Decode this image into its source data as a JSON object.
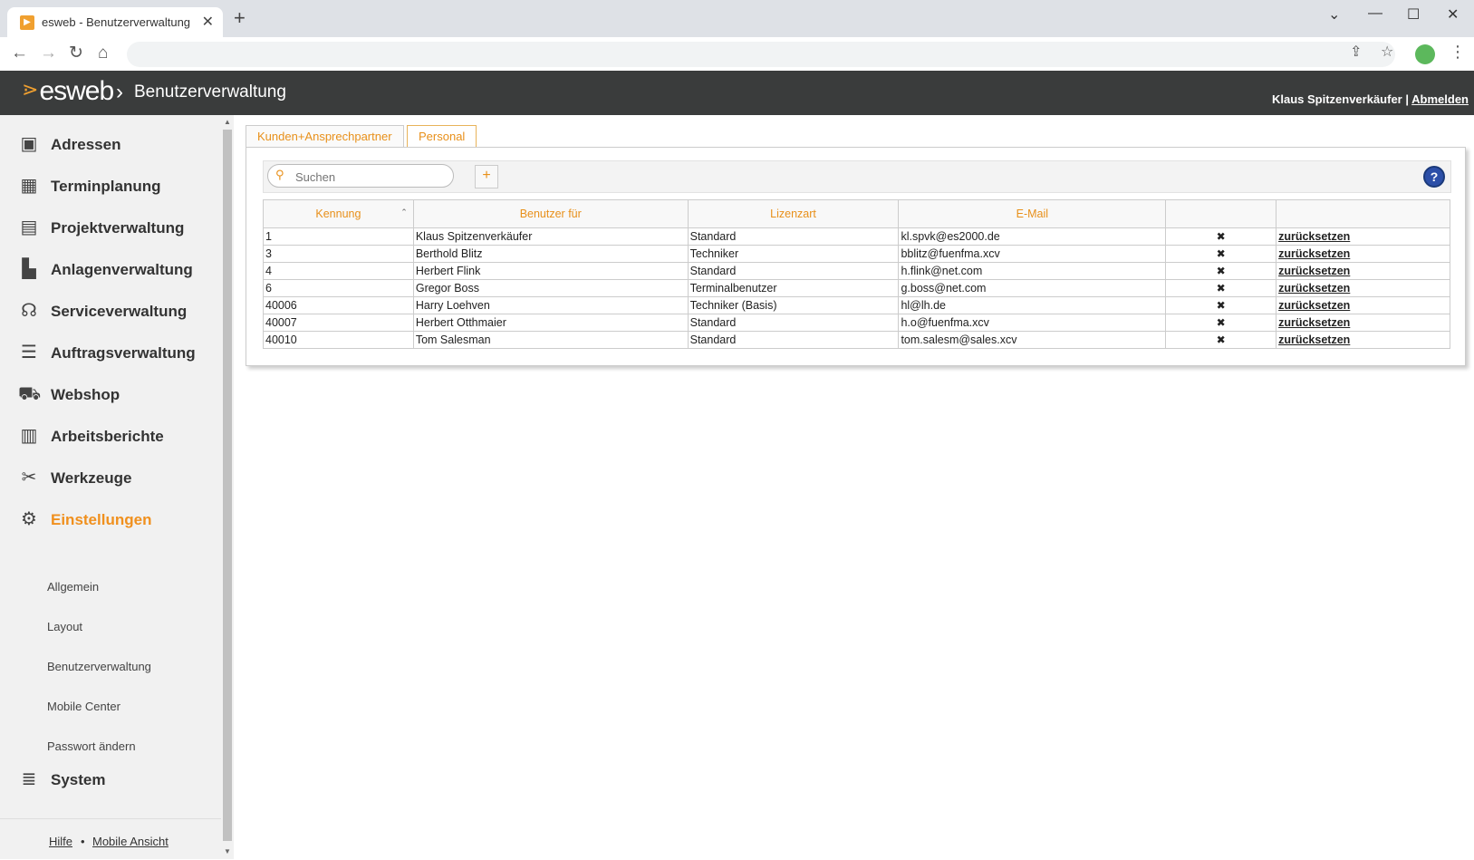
{
  "browser": {
    "tab_title": "esweb - Benutzerverwaltung",
    "tab_close": "✕",
    "new_tab": "+"
  },
  "header": {
    "logo": "esweb",
    "breadcrumb": "Benutzerverwaltung",
    "user_name": "Klaus Spitzenverkäufer",
    "separator": "|",
    "logout": "Abmelden"
  },
  "sidebar": {
    "items": [
      {
        "label": "Adressen",
        "icon": "address-book-icon"
      },
      {
        "label": "Terminplanung",
        "icon": "calendar-icon"
      },
      {
        "label": "Projektverwaltung",
        "icon": "gantt-icon"
      },
      {
        "label": "Anlagenverwaltung",
        "icon": "factory-icon"
      },
      {
        "label": "Serviceverwaltung",
        "icon": "headset-icon"
      },
      {
        "label": "Auftragsverwaltung",
        "icon": "list-icon"
      },
      {
        "label": "Webshop",
        "icon": "cart-icon"
      },
      {
        "label": "Arbeitsberichte",
        "icon": "clipboard-icon"
      },
      {
        "label": "Werkzeuge",
        "icon": "tools-icon"
      },
      {
        "label": "Einstellungen",
        "icon": "gears-icon"
      }
    ],
    "sub_items": [
      "Allgemein",
      "Layout",
      "Benutzerverwaltung",
      "Mobile Center",
      "Passwort ändern"
    ],
    "system": "System",
    "footer": {
      "help": "Hilfe",
      "dot": "•",
      "mobile": "Mobile Ansicht"
    }
  },
  "content": {
    "tabs": [
      "Kunden+Ansprechpartner",
      "Personal"
    ],
    "active_tab": "Personal",
    "search_placeholder": "Suchen",
    "add_label": "+",
    "help_label": "?",
    "columns": [
      "Kennung",
      "Benutzer für",
      "Lizenzart",
      "E-Mail",
      "",
      ""
    ],
    "rows": [
      {
        "id": "1",
        "user": "Klaus Spitzenverkäufer",
        "license": "Standard",
        "email": "kl.spvk@es2000.de",
        "del": "✖",
        "reset": "zurücksetzen"
      },
      {
        "id": "3",
        "user": "Berthold Blitz",
        "license": "Techniker",
        "email": "bblitz@fuenfma.xcv",
        "del": "✖",
        "reset": "zurücksetzen"
      },
      {
        "id": "4",
        "user": "Herbert Flink",
        "license": "Standard",
        "email": "h.flink@net.com",
        "del": "✖",
        "reset": "zurücksetzen"
      },
      {
        "id": "6",
        "user": "Gregor Boss",
        "license": "Terminalbenutzer",
        "email": "g.boss@net.com",
        "del": "✖",
        "reset": "zurücksetzen"
      },
      {
        "id": "40006",
        "user": "Harry Loehven",
        "license": "Techniker (Basis)",
        "email": "hl@lh.de",
        "del": "✖",
        "reset": "zurücksetzen"
      },
      {
        "id": "40007",
        "user": "Herbert Otthmaier",
        "license": "Standard",
        "email": "h.o@fuenfma.xcv",
        "del": "✖",
        "reset": "zurücksetzen"
      },
      {
        "id": "40010",
        "user": "Tom Salesman",
        "license": "Standard",
        "email": "tom.salesm@sales.xcv",
        "del": "✖",
        "reset": "zurücksetzen"
      }
    ]
  }
}
